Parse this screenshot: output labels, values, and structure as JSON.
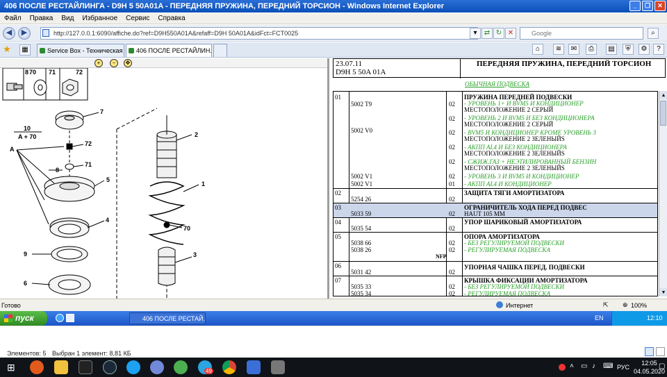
{
  "window": {
    "title": "406 ПОСЛЕ РЕСТАЙЛИНГА - D9H 5 50A01A - ПЕРЕДНЯЯ ПРУЖИНА, ПЕРЕДНИЙ ТОРСИОН - Windows Internet Explorer"
  },
  "menu": [
    "Файл",
    "Правка",
    "Вид",
    "Избранное",
    "Сервис",
    "Справка"
  ],
  "address": {
    "url": "http://127.0.0.1:6090/affiche.do?ref=D9H550A01A&refaff=D9H 50A01A&idFct=FCT0025",
    "search_placeholder": "Google"
  },
  "tabs": [
    {
      "label": "Service Box - Техническая ..."
    },
    {
      "label": "406 ПОСЛЕ РЕСТАЙЛИН..."
    }
  ],
  "diagram": {
    "thumbs": [
      "8",
      "70",
      "71",
      "72"
    ],
    "labels": [
      "7",
      "10",
      "A + 70",
      "A",
      "72",
      "8",
      "71",
      "5",
      "4",
      "9",
      "6",
      "2",
      "1",
      "70",
      "3"
    ]
  },
  "header": {
    "date": "23.07.11",
    "code": "D9H 5 50A 01A",
    "title": "ПЕРЕДНЯЯ ПРУЖИНА, ПЕРЕДНИЙ ТОРСИОН"
  },
  "section": "ОБЫЧНАЯ ПОДВЕСКА",
  "rows": [
    {
      "num": "01",
      "ref": "5002 T9",
      "qty": "02",
      "title": "ПРУЖИНА ПЕРЕДНЕЙ ПОДВЕСКИ",
      "line1": "- УРОВЕНЬ 1+ И BVM5 И КОНДИЦИОНЕР",
      "line2": "МЕСТОПОЛОЖЕНИЕ 2 СЕРЫЙ"
    },
    {
      "ref": "5002 V0",
      "qty1": "02",
      "line1": "- УРОВЕНЬ 2 И BVM5 И БЕЗ КОНДИЦИОНЕРА",
      "line2": "МЕСТОПОЛОЖЕНИЕ 2 СЕРЫЙ",
      "qty2": "02",
      "line3": "- BVM5 И КОНДИЦИОНЕР КРОМЕ УРОВЕНЬ 3",
      "line4": "МЕСТОПОЛОЖЕНИЕ 2 ЗЕЛЕНЫЙЅ",
      "qty3": "02",
      "line5": "- АКПП AL4 И БЕЗ КОНДИЦИОНЕРА",
      "line6": "МЕСТОПОЛОЖЕНИЕ 2 ЗЕЛЕНЫЙЅ",
      "qty4": "02",
      "line7": "- СЖИЖ.ГАЗ + НЕЭТИЛИРОВАННЫЙ БЕНЗИН",
      "line8": "МЕСТОПОЛОЖЕНИЕ 2 ЗЕЛЕНЫЙЅ"
    },
    {
      "ref": "5002 V1",
      "qty": "02",
      "line": "- УРОВЕНЬ 3 И BVM5 И КОНДИЦИОНЕР"
    },
    {
      "ref": "5002 V1",
      "qty": "01",
      "line": "- АКПП AL4 И КОНДИЦИОНЕР"
    },
    {
      "num": "02",
      "ref": "5254 26",
      "qty": "02",
      "title": "ЗАЩИТА ТЯГИ АМОРТИЗАТОРА"
    },
    {
      "num": "03",
      "ref": "5033 59",
      "qty": "02",
      "title": "ОГРАНИЧИТЕЛЬ ХОДА ПЕРЕД ПОДВЕС",
      "line": "HAUT 105 MM"
    },
    {
      "num": "04",
      "ref": "5035 54",
      "qty": "02",
      "title": "УПОР ШАРИКОВЫЙ АМОРТИЗАТОРА"
    },
    {
      "num": "05",
      "ref1": "5038 66",
      "ref2": "5038 26",
      "nfp": "NFP",
      "qty1": "02",
      "qty2": "02",
      "title": "ОПОРА АМОРТИЗАТОРА",
      "line1": "- БЕЗ РЕГУЛИРУЕМОЙ ПОДВЕСКИ",
      "line2": "- РЕГУЛИРУЕМАЯ ПОДВЕСКА"
    },
    {
      "num": "06",
      "ref": "5031 42",
      "qty": "02",
      "title": "УПОРНАЯ ЧАШКА ПЕРЕД. ПОДВЕСКИ"
    },
    {
      "num": "07",
      "ref1": "5035 33",
      "ref2": "5035 34",
      "qty1": "02",
      "qty2": "02",
      "title": "КРЫШКА ФИКСАЦИИ АМОРТИЗАТОРА",
      "line1": "- БЕЗ РЕГУЛИРУЕМОЙ ПОДВЕСКИ",
      "line2": "- РЕГУЛИРУЕМАЯ ПОДВЕСКА"
    }
  ],
  "status": {
    "left": "Готово",
    "zone": "Интернет",
    "zoom": "100%"
  },
  "xp_taskbar": {
    "start": "пуск",
    "task": "406 ПОСЛЕ РЕСТАЙ...",
    "lang": "EN",
    "time": "12:10"
  },
  "explorer_status": {
    "items": "Элементов: 5",
    "selected": "Выбран 1 элемент: 8,81 КБ"
  },
  "win_taskbar": {
    "lang": "РУС",
    "time": "12:05",
    "date": "04.05.2020",
    "badge": "49"
  },
  "colors": {
    "green_text": "#2aa02a",
    "selection": "#cbd6ea",
    "xp_blue": "#1c55c8"
  }
}
